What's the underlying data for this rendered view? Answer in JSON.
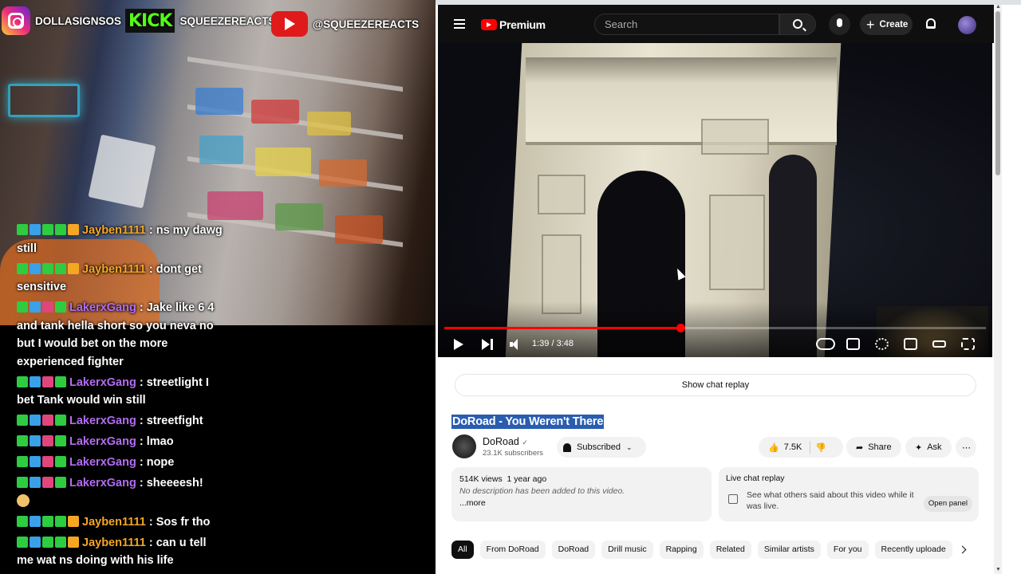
{
  "overlay": {
    "instagram": "DOLLASIGNSOS",
    "kick_logo": "KICK",
    "kick_handle": "SQUEEZEREACTS",
    "youtube_handle": "@SQUEEZEREACTS"
  },
  "chat": [
    {
      "user": "Jayben1111",
      "color": "#f5a623",
      "text": "ns my dawg still",
      "badges": [
        "#2ecc40",
        "#3aa0e8",
        "#2ecc40",
        "#2ecc40",
        "#f5a623"
      ]
    },
    {
      "user": "Jayben1111",
      "color": "#f5a623",
      "text": "dont get sensitive",
      "badges": [
        "#2ecc40",
        "#3aa0e8",
        "#2ecc40",
        "#2ecc40",
        "#f5a623"
      ]
    },
    {
      "user": "LakerxGang",
      "color": "#b36cf3",
      "text": "Jake like 6 4 and tank hella short so you neva no but I would bet on the more experienced fighter",
      "badges": [
        "#2ecc40",
        "#3aa0e8",
        "#e0457b",
        "#2ecc40"
      ]
    },
    {
      "user": "LakerxGang",
      "color": "#b36cf3",
      "text": "streetlight I bet Tank would win still",
      "badges": [
        "#2ecc40",
        "#3aa0e8",
        "#e0457b",
        "#2ecc40"
      ]
    },
    {
      "user": "LakerxGang",
      "color": "#b36cf3",
      "text": "streetfight",
      "badges": [
        "#2ecc40",
        "#3aa0e8",
        "#e0457b",
        "#2ecc40"
      ]
    },
    {
      "user": "LakerxGang",
      "color": "#b36cf3",
      "text": "lmao",
      "badges": [
        "#2ecc40",
        "#3aa0e8",
        "#e0457b",
        "#2ecc40"
      ]
    },
    {
      "user": "LakerxGang",
      "color": "#b36cf3",
      "text": "nope",
      "badges": [
        "#2ecc40",
        "#3aa0e8",
        "#e0457b",
        "#2ecc40"
      ]
    },
    {
      "user": "LakerxGang",
      "color": "#b36cf3",
      "text": "sheeeesh!",
      "badges": [
        "#2ecc40",
        "#3aa0e8",
        "#e0457b",
        "#2ecc40"
      ],
      "emoji": true
    },
    {
      "user": "Jayben1111",
      "color": "#f5a623",
      "text": "Sos fr tho",
      "badges": [
        "#2ecc40",
        "#3aa0e8",
        "#2ecc40",
        "#2ecc40",
        "#f5a623"
      ]
    },
    {
      "user": "Jayben1111",
      "color": "#f5a623",
      "text": "can u tell me wat ns doing with his life",
      "badges": [
        "#2ecc40",
        "#3aa0e8",
        "#2ecc40",
        "#2ecc40",
        "#f5a623"
      ]
    }
  ],
  "youtube": {
    "logo_text": "Premium",
    "search_placeholder": "Search",
    "create_label": "Create",
    "player": {
      "time": "1:39 / 3:48",
      "progress": 0.436
    },
    "show_chat_replay": "Show chat replay",
    "video_title": "DoRoad - You Weren't There",
    "channel_name": "DoRoad",
    "subscribers": "23.1K subscribers",
    "subscribed_label": "Subscribed",
    "likes": "7.5K",
    "share_label": "Share",
    "ask_label": "Ask",
    "views": "514K views",
    "age": "1 year ago",
    "description": "No description has been added to this video.",
    "more_label": "...more",
    "live_chat_title": "Live chat replay",
    "live_chat_text": "See what others said about this video while it was live.",
    "open_panel": "Open panel",
    "chips": [
      "All",
      "From DoRoad",
      "DoRoad",
      "Drill music",
      "Rapping",
      "Related",
      "Similar artists",
      "For you",
      "Recently uploade"
    ]
  }
}
